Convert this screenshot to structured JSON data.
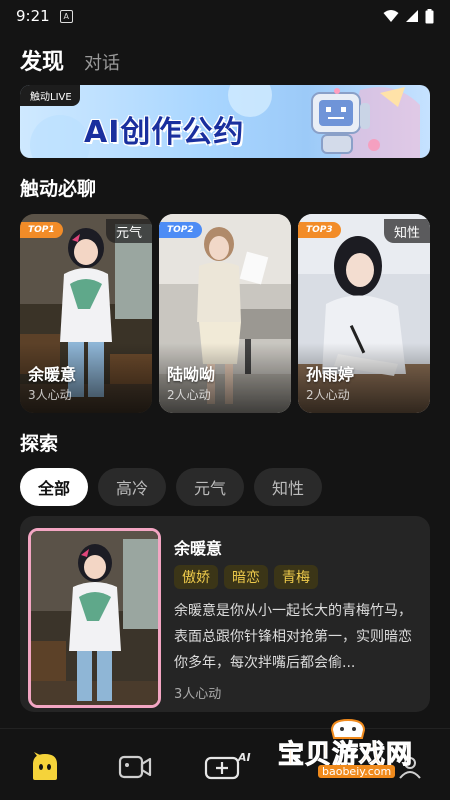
{
  "status_bar": {
    "time": "9:21",
    "notif_icon": "A"
  },
  "top_tabs": {
    "discover": "发现",
    "chat": "对话"
  },
  "banner": {
    "tag": "触动LIVE",
    "title": "AI创作公约"
  },
  "sections": {
    "hot": "触动必聊",
    "explore": "探索"
  },
  "hot_cards": [
    {
      "rank": "TOP1",
      "tag": "元气",
      "name": "余暖意",
      "likes": "3人心动",
      "rank_color": "#f28c28"
    },
    {
      "rank": "TOP2",
      "tag": "",
      "name": "陆呦呦",
      "likes": "2人心动",
      "rank_color": "#4d8cf5"
    },
    {
      "rank": "TOP3",
      "tag": "知性",
      "name": "孙雨婷",
      "likes": "2人心动",
      "rank_color": "#f28c28"
    }
  ],
  "filters": [
    "全部",
    "高冷",
    "元气",
    "知性"
  ],
  "list_item": {
    "name": "余暖意",
    "tags": [
      "傲娇",
      "暗恋",
      "青梅"
    ],
    "desc": "余暖意是你从小一起长大的青梅竹马，表面总跟你针锋相对抢第一，实则暗恋你多年，每次拌嘴后都会偷...",
    "likes": "3人心动"
  },
  "bottom_nav": {
    "ai_label": "AI"
  },
  "watermark": {
    "text": "宝贝游戏网",
    "url": "baobeiy.com"
  },
  "colors": {
    "accent_yellow": "#f5d33a",
    "tag_bg": "#3b3517",
    "tag_text": "#ecc94b",
    "pink_border": "#f3a6c3"
  }
}
